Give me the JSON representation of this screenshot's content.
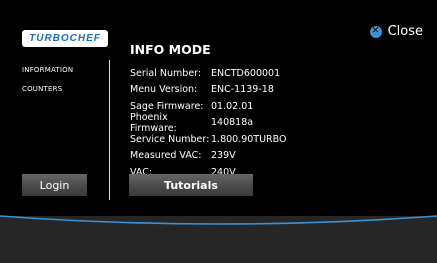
{
  "brand": {
    "logo_text": "TURBOCHEF"
  },
  "header": {
    "title": "INFO MODE",
    "close_label": "Close",
    "close_icon": "x-circle-icon"
  },
  "sidebar": {
    "items": [
      {
        "label": "INFORMATION"
      },
      {
        "label": "COUNTERS"
      }
    ]
  },
  "info": {
    "rows": [
      {
        "label": "Serial Number:",
        "value": "ENCTD600001"
      },
      {
        "label": "Menu Version:",
        "value": "ENC-1139-18"
      },
      {
        "label": "Sage Firmware:",
        "value": "01.02.01"
      },
      {
        "label": "Phoenix Firmware:",
        "value": "140818a"
      },
      {
        "label": "Service Number:",
        "value": "1.800.90TURBO"
      },
      {
        "label": "Measured VAC:",
        "value": "239V"
      },
      {
        "label": "VAC:",
        "value": "240V"
      }
    ]
  },
  "buttons": {
    "login": "Login",
    "tutorials": "Tutorials"
  },
  "colors": {
    "accent": "#3a92d6",
    "background": "#000000",
    "footer": "#262626"
  }
}
